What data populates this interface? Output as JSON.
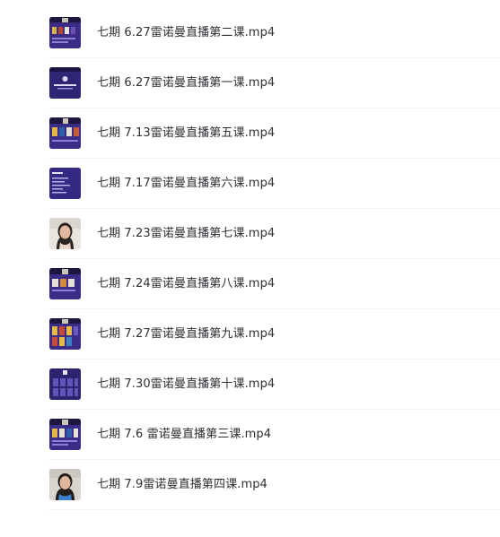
{
  "files": [
    {
      "name": "七期 6.27雷诺曼直播第二课.mp4",
      "thumbnail": "video-thumbnail-slides"
    },
    {
      "name": "七期 6.27雷诺曼直播第一课.mp4",
      "thumbnail": "video-thumbnail-title-slide"
    },
    {
      "name": "七期 7.13雷诺曼直播第五课.mp4",
      "thumbnail": "video-thumbnail-cards"
    },
    {
      "name": "七期 7.17雷诺曼直播第六课.mp4",
      "thumbnail": "video-thumbnail-text-slide"
    },
    {
      "name": "七期 7.23雷诺曼直播第七课.mp4",
      "thumbnail": "video-thumbnail-presenter"
    },
    {
      "name": "七期 7.24雷诺曼直播第八课.mp4",
      "thumbnail": "video-thumbnail-cards"
    },
    {
      "name": "七期 7.27雷诺曼直播第九课.mp4",
      "thumbnail": "video-thumbnail-cards"
    },
    {
      "name": "七期 7.30雷诺曼直播第十课.mp4",
      "thumbnail": "video-thumbnail-card-grid"
    },
    {
      "name": "七期 7.6 雷诺曼直播第三课.mp4",
      "thumbnail": "video-thumbnail-cards"
    },
    {
      "name": "七期 7.9雷诺曼直播第四课.mp4",
      "thumbnail": "video-thumbnail-presenter"
    }
  ]
}
